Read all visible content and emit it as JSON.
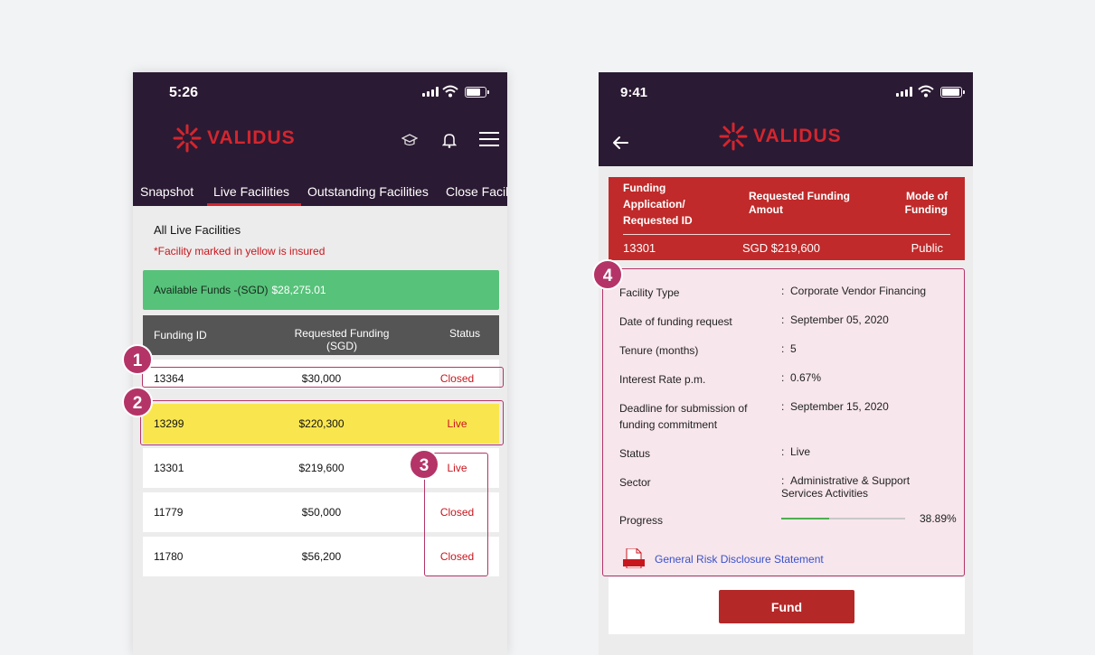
{
  "colors": {
    "header_bg": "#2b1a33",
    "brand_red": "#d3262e",
    "funds_green": "#57c27a",
    "insured_yellow": "#f9e64f",
    "badge_magenta": "#b43468",
    "link_blue": "#3a52c9"
  },
  "left_screen": {
    "status_time": "5:26",
    "brand": "VALIDUS",
    "header_icons": [
      "graduation-cap-icon",
      "bell-icon",
      "hamburger-menu-icon"
    ],
    "tabs": [
      {
        "label": "Snapshot",
        "active": false
      },
      {
        "label": "Live Facilities",
        "active": true
      },
      {
        "label": "Outstanding Facilities",
        "active": false
      },
      {
        "label": "Close Facili",
        "active": false
      }
    ],
    "section_title": "All Live Facilities",
    "insured_note": "*Facility marked in yellow is insured",
    "available_funds_label": "Available Funds -(SGD)",
    "available_funds_value": "$28,275.01",
    "table_headers": {
      "funding_id": "Funding ID",
      "requested_funding": "Requested Funding",
      "requested_funding_unit": "(SGD)",
      "status": "Status"
    },
    "rows": [
      {
        "id": "13364",
        "amount": "$30,000",
        "status": "Closed",
        "insured": false
      },
      {
        "id": "13299",
        "amount": "$220,300",
        "status": "Live",
        "insured": true
      },
      {
        "id": "13301",
        "amount": "$219,600",
        "status": "Live",
        "insured": false
      },
      {
        "id": "11779",
        "amount": "$50,000",
        "status": "Closed",
        "insured": false
      },
      {
        "id": "11780",
        "amount": "$56,200",
        "status": "Closed",
        "insured": false
      }
    ],
    "badges": [
      "1",
      "2",
      "3"
    ]
  },
  "right_screen": {
    "status_time": "9:41",
    "brand": "VALIDUS",
    "card_header": {
      "col1": [
        "Funding",
        "Application/",
        "Requested ID"
      ],
      "col2": [
        "Requested Funding",
        "Amout"
      ],
      "col3": [
        "Mode of",
        "Funding"
      ],
      "id_value": "13301",
      "amount_value": "SGD $219,600",
      "mode_value": "Public"
    },
    "badge": "4",
    "details": [
      {
        "label": "Facility Type",
        "value": "Corporate Vendor Financing"
      },
      {
        "label": "Date of funding request",
        "value": "September 05, 2020"
      },
      {
        "label": "Tenure (months)",
        "value": "5"
      },
      {
        "label": "Interest Rate p.m.",
        "value": "0.67%"
      },
      {
        "label": "Deadline for submission of funding commitment",
        "value": "September 15, 2020"
      },
      {
        "label": "Status",
        "value": "Live"
      },
      {
        "label": "Sector",
        "value": "Administrative & Support Services Activities"
      }
    ],
    "separator": ":",
    "progress_label": "Progress",
    "progress_text": "38.89%",
    "progress_fraction": 0.3889,
    "link_text": "General Risk Disclosure Statement",
    "fund_button": "Fund"
  }
}
